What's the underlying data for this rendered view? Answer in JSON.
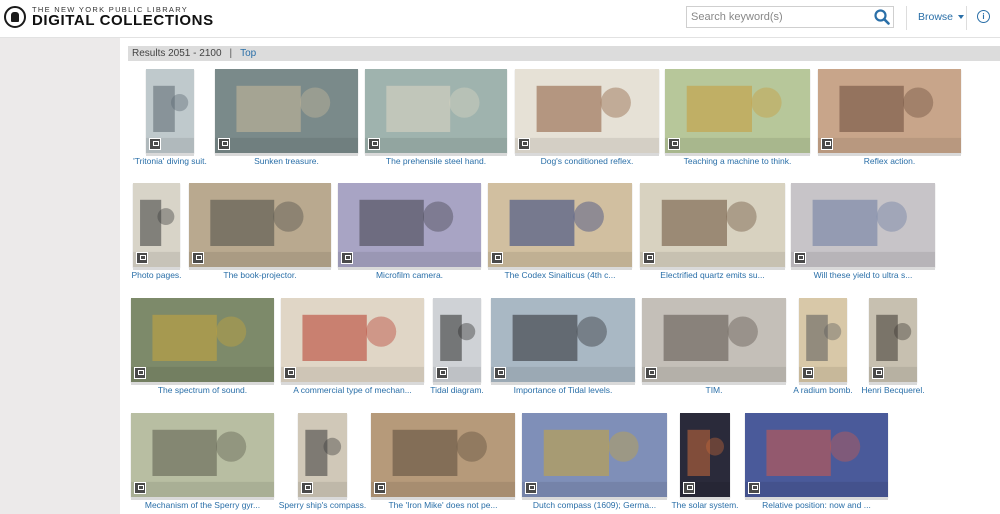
{
  "header": {
    "logo_line1": "THE NEW YORK PUBLIC LIBRARY",
    "logo_line2": "DIGITAL COLLECTIONS",
    "search_placeholder": "Search keyword(s)",
    "browse_label": "Browse"
  },
  "results": {
    "range": "Results 2051 - 2100",
    "divider": "|",
    "top_label": "Top"
  },
  "items": [
    {
      "caption": "'Tritonia' diving suit.",
      "bg": "#bfc9cc",
      "accent": "#5b6670"
    },
    {
      "caption": "Sunken treasure.",
      "bg": "#7a8a8a",
      "accent": "#c9b99b"
    },
    {
      "caption": "The prehensile steel hand.",
      "bg": "#9fb3ae",
      "accent": "#dcd6c4"
    },
    {
      "caption": "Dog's conditioned reflex.",
      "bg": "#e6e1d6",
      "accent": "#8a5a3a"
    },
    {
      "caption": "Teaching a machine to think.",
      "bg": "#b7c79a",
      "accent": "#c99a3a"
    },
    {
      "caption": "Reflex action.",
      "bg": "#c8a58a",
      "accent": "#6a4a3a"
    },
    {
      "caption": "Photo pages.",
      "bg": "#d8d4c8",
      "accent": "#3a3a3a"
    },
    {
      "caption": "The book-projector.",
      "bg": "#b9a98f",
      "accent": "#4a4a46"
    },
    {
      "caption": "Microfilm camera.",
      "bg": "#a8a4c4",
      "accent": "#3e3e48"
    },
    {
      "caption": "The Codex Sinaiticus (4th c...",
      "bg": "#d1bfa0",
      "accent": "#2c3f80"
    },
    {
      "caption": "Electrified quartz emits su...",
      "bg": "#d8d2c0",
      "accent": "#6a4e36"
    },
    {
      "caption": "Will these yield to ultra s...",
      "bg": "#c7c4c8",
      "accent": "#6a7aa0"
    },
    {
      "caption": "The spectrum of sound.",
      "bg": "#7d8a6a",
      "accent": "#c9a63a"
    },
    {
      "caption": "A commercial type of mechan...",
      "bg": "#e0d6c6",
      "accent": "#b63a2a"
    },
    {
      "caption": "Tidal diagram.",
      "bg": "#cfd2d6",
      "accent": "#2a2a2a"
    },
    {
      "caption": "Importance of Tidal levels.",
      "bg": "#a9b8c4",
      "accent": "#2a2a30"
    },
    {
      "caption": "TIM.",
      "bg": "#c4bfb8",
      "accent": "#5a5048"
    },
    {
      "caption": "A radium bomb.",
      "bg": "#d8c8a8",
      "accent": "#5a5a5a"
    },
    {
      "caption": "Henri Becquerel.",
      "bg": "#c7c0b0",
      "accent": "#3a3430"
    },
    {
      "caption": "Mechanism of the Sperry gyr...",
      "bg": "#b8bea2",
      "accent": "#5a5a4a"
    },
    {
      "caption": "Sperry ship's compass.",
      "bg": "#d0c8b8",
      "accent": "#3a3a3a"
    },
    {
      "caption": "The 'Iron Mike' does not pe...",
      "bg": "#b69a7a",
      "accent": "#5a4a3a"
    },
    {
      "caption": "Dutch compass (1609); Germa...",
      "bg": "#7f8fb8",
      "accent": "#c9a63a"
    },
    {
      "caption": "The solar system.",
      "bg": "#2a2a3a",
      "accent": "#c86a3a"
    },
    {
      "caption": "Relative position: now and ...",
      "bg": "#4a5a9a",
      "accent": "#d05a4a"
    }
  ]
}
